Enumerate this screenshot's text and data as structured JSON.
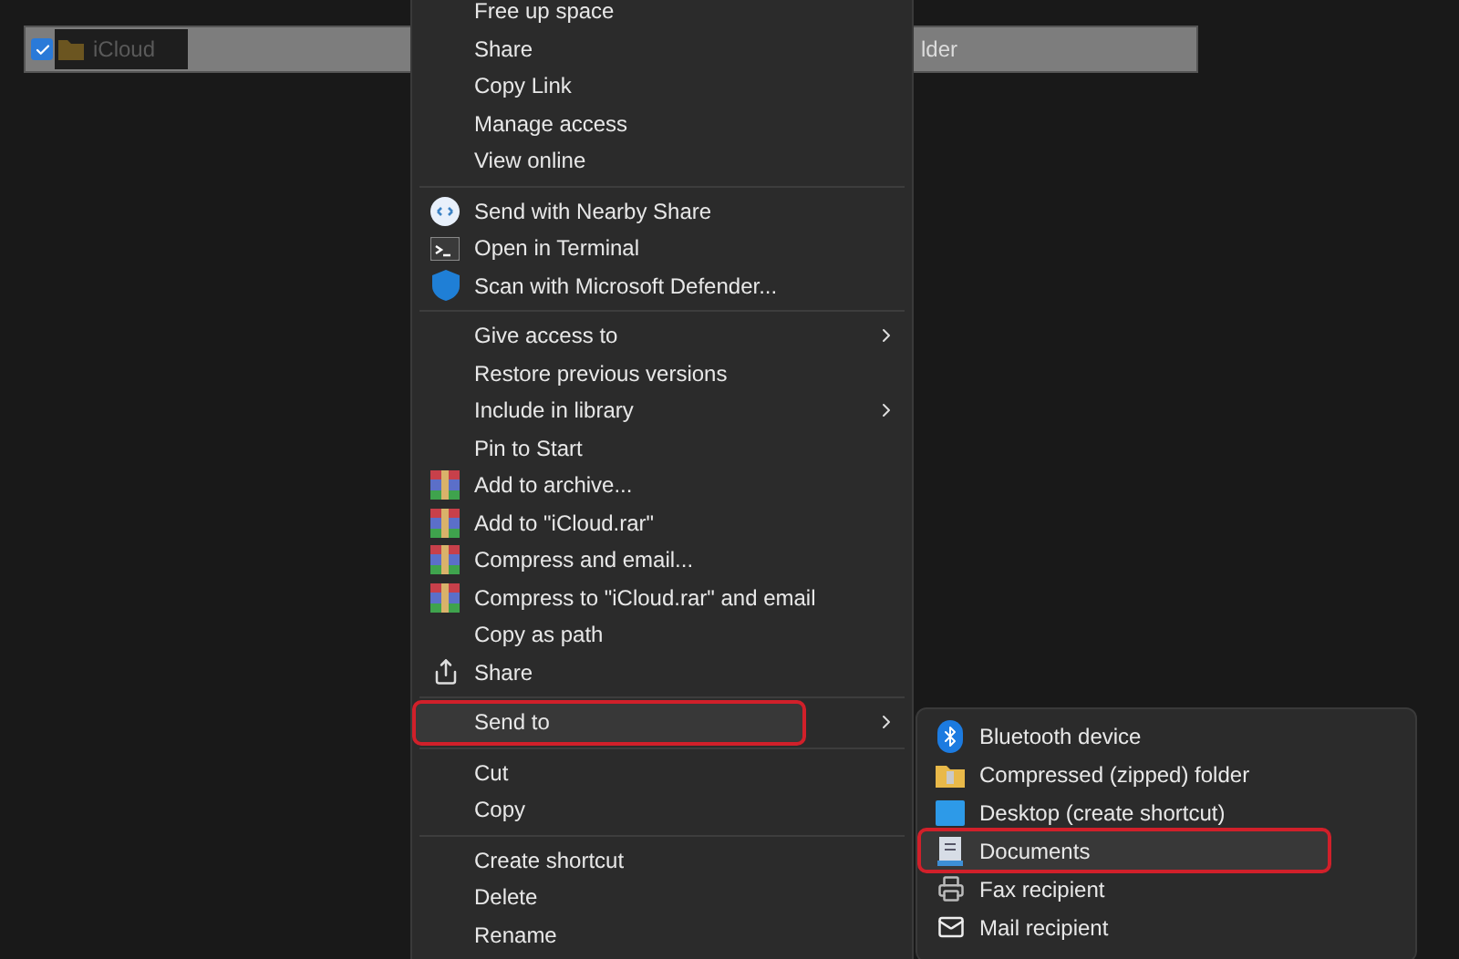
{
  "file_row": {
    "checked": true,
    "selected": true,
    "name": "iCloud",
    "column_2": "lder"
  },
  "context_menu": {
    "items": [
      {
        "kind": "plain",
        "label": "Free up space",
        "submenu": false,
        "highlighted": false,
        "outlined": false
      },
      {
        "kind": "plain",
        "label": "Share",
        "submenu": false,
        "highlighted": false,
        "outlined": false
      },
      {
        "kind": "plain",
        "label": "Copy Link",
        "submenu": false,
        "highlighted": false,
        "outlined": false
      },
      {
        "kind": "plain",
        "label": "Manage access",
        "submenu": false,
        "highlighted": false,
        "outlined": false
      },
      {
        "kind": "plain",
        "label": "View online",
        "submenu": false,
        "highlighted": false,
        "outlined": false
      },
      {
        "kind": "separator"
      },
      {
        "kind": "nearby",
        "label": "Send with Nearby Share",
        "submenu": false,
        "highlighted": false,
        "outlined": false
      },
      {
        "kind": "terminal",
        "label": "Open in Terminal",
        "submenu": false,
        "highlighted": false,
        "outlined": false
      },
      {
        "kind": "shield",
        "label": "Scan with Microsoft Defender...",
        "submenu": false,
        "highlighted": false,
        "outlined": false
      },
      {
        "kind": "separator"
      },
      {
        "kind": "plain",
        "label": "Give access to",
        "submenu": true,
        "highlighted": false,
        "outlined": false
      },
      {
        "kind": "plain",
        "label": "Restore previous versions",
        "submenu": false,
        "highlighted": false,
        "outlined": false
      },
      {
        "kind": "plain",
        "label": "Include in library",
        "submenu": true,
        "highlighted": false,
        "outlined": false
      },
      {
        "kind": "plain",
        "label": "Pin to Start",
        "submenu": false,
        "highlighted": false,
        "outlined": false
      },
      {
        "kind": "archive",
        "label": "Add to archive...",
        "submenu": false,
        "highlighted": false,
        "outlined": false
      },
      {
        "kind": "archive",
        "label": "Add to \"iCloud.rar\"",
        "submenu": false,
        "highlighted": false,
        "outlined": false
      },
      {
        "kind": "archive",
        "label": "Compress and email...",
        "submenu": false,
        "highlighted": false,
        "outlined": false
      },
      {
        "kind": "archive",
        "label": "Compress to \"iCloud.rar\" and email",
        "submenu": false,
        "highlighted": false,
        "outlined": false
      },
      {
        "kind": "plain",
        "label": "Copy as path",
        "submenu": false,
        "highlighted": false,
        "outlined": false
      },
      {
        "kind": "share",
        "label": "Share",
        "submenu": false,
        "highlighted": false,
        "outlined": false
      },
      {
        "kind": "separator"
      },
      {
        "kind": "plain",
        "label": "Send to",
        "submenu": true,
        "highlighted": true,
        "outlined": true
      },
      {
        "kind": "separator"
      },
      {
        "kind": "plain",
        "label": "Cut",
        "submenu": false,
        "highlighted": false,
        "outlined": false
      },
      {
        "kind": "plain",
        "label": "Copy",
        "submenu": false,
        "highlighted": false,
        "outlined": false
      },
      {
        "kind": "separator"
      },
      {
        "kind": "plain",
        "label": "Create shortcut",
        "submenu": false,
        "highlighted": false,
        "outlined": false
      },
      {
        "kind": "plain",
        "label": "Delete",
        "submenu": false,
        "highlighted": false,
        "outlined": false
      },
      {
        "kind": "plain",
        "label": "Rename",
        "submenu": false,
        "highlighted": false,
        "outlined": false
      }
    ]
  },
  "send_to_menu": {
    "items": [
      {
        "kind": "bluetooth",
        "label": "Bluetooth device",
        "highlighted": false,
        "outlined": false
      },
      {
        "kind": "zip",
        "label": "Compressed (zipped) folder",
        "highlighted": false,
        "outlined": false
      },
      {
        "kind": "desktop",
        "label": "Desktop (create shortcut)",
        "highlighted": false,
        "outlined": false
      },
      {
        "kind": "documents",
        "label": "Documents",
        "highlighted": true,
        "outlined": true
      },
      {
        "kind": "fax",
        "label": "Fax recipient",
        "highlighted": false,
        "outlined": false
      },
      {
        "kind": "mail",
        "label": "Mail recipient",
        "highlighted": false,
        "outlined": false
      }
    ]
  }
}
